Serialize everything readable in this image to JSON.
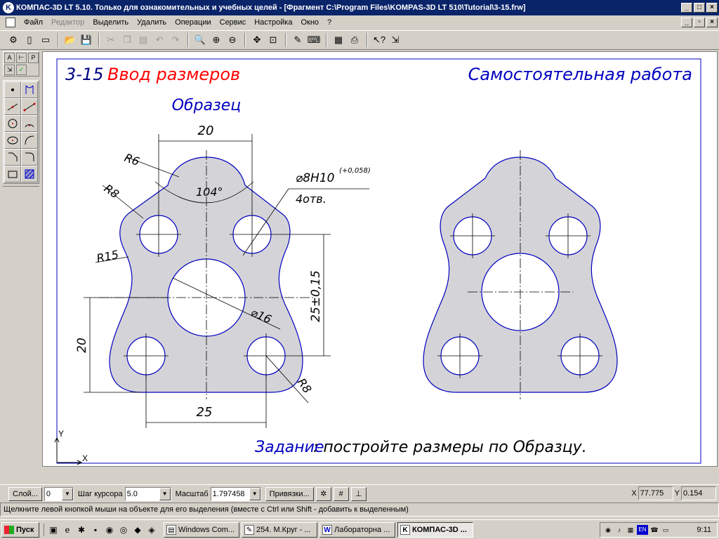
{
  "window": {
    "title": "КОМПАС-3D LT 5.10. Только для ознакомительных и учебных целей - [Фрагмент C:\\Program Files\\KOMPAS-3D LT 510\\Tutorial\\3-15.frw]",
    "app_icon": "kompas-logo-icon"
  },
  "menu": {
    "items": [
      {
        "label": "Файл",
        "enabled": true
      },
      {
        "label": "Редактор",
        "enabled": false
      },
      {
        "label": "Выделить",
        "enabled": true
      },
      {
        "label": "Удалить",
        "enabled": true
      },
      {
        "label": "Операции",
        "enabled": true
      },
      {
        "label": "Сервис",
        "enabled": true
      },
      {
        "label": "Настройка",
        "enabled": true
      },
      {
        "label": "Окно",
        "enabled": true
      },
      {
        "label": "?",
        "enabled": true
      }
    ]
  },
  "drawing": {
    "title_num": "3-15",
    "title_text": "Ввод размеров",
    "right_title": "Самостоятельная работа",
    "sample_label": "Образец",
    "task_label": "Задание",
    "task_text": ": постройте размеры по Образцу.",
    "dimensions": {
      "top_width": "20",
      "r6": "R6",
      "r8_left": "R8",
      "r15": "R15",
      "angle": "104°",
      "hole_dia": "⌀8H10",
      "hole_tol": "(+0,058)",
      "holes_count": "4отв.",
      "center_dia": "⌀16",
      "right_height": "25±0,15",
      "left_height": "20",
      "bottom_width": "25",
      "r8_bottom": "R8"
    },
    "axis_x": "X",
    "axis_y": "Y",
    "colors": {
      "title_num": "#000080",
      "title_text": "#ff0000",
      "right_title": "#0000c0",
      "outline": "#0000c0",
      "fill": "#d4d4d8"
    }
  },
  "statusbar": {
    "layer_btn": "Слой...",
    "layer_value": "0",
    "step_label": "Шаг курсора",
    "step_value": "5.0",
    "scale_label": "Масштаб",
    "scale_value": "1.797458",
    "snap_btn": "Привязки...",
    "x_label": "X",
    "x_value": "77.775",
    "y_label": "Y",
    "y_value": "0.154"
  },
  "hint": "Щелкните левой кнопкой мыши на объекте для его выделения (вместе с Ctrl или Shift - добавить к выделенным)",
  "taskbar": {
    "start": "Пуск",
    "buttons": [
      {
        "label": "Windows Com...",
        "active": false
      },
      {
        "label": "254. М.Круг - ...",
        "active": false
      },
      {
        "label": "Лабораторна ...",
        "active": false
      },
      {
        "label": "КОМПАС-3D ...",
        "active": true
      }
    ],
    "tray_lang": "EN",
    "time": "9:11"
  }
}
